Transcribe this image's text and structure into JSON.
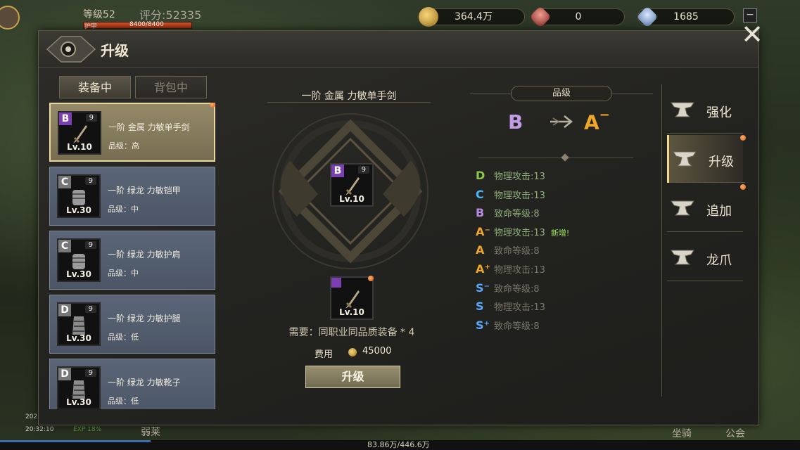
{
  "hud": {
    "level": "等级52",
    "score": "评分:52335",
    "hp_label": "护甲",
    "hp_value": "8400/8400",
    "hp_fraction": 1.0,
    "gold": "364.4万",
    "ruby": "0",
    "crystal": "1685",
    "minimize": "−",
    "date": "202",
    "time": "20:32:10",
    "exp_label": "EXP 18%",
    "exp_total": "83.86万/446.6万",
    "exp_fraction": 0.188,
    "skill_label": "弱莱",
    "mount_label": "坐骑",
    "guild_label": "公会"
  },
  "panel": {
    "title": "升级",
    "close": "✕"
  },
  "tabs": {
    "equipped": "装备中",
    "bag": "背包中"
  },
  "items": [
    {
      "grade": "B",
      "stack": "9",
      "level": "Lv.10",
      "name": "一阶 金属 力敏单手剑",
      "quality": "品级：高",
      "selected": true,
      "dot": true
    },
    {
      "grade": "C",
      "stack": "9",
      "level": "Lv.30",
      "name": "一阶 绿龙 力敏铠甲",
      "quality": "品级：中",
      "selected": false,
      "dot": false
    },
    {
      "grade": "C",
      "stack": "9",
      "level": "Lv.30",
      "name": "一阶 绿龙 力敏护肩",
      "quality": "品级：中",
      "selected": false,
      "dot": false
    },
    {
      "grade": "D",
      "stack": "9",
      "level": "Lv.30",
      "name": "一阶 绿龙 力敏护腿",
      "quality": "品级：低",
      "selected": false,
      "dot": false
    },
    {
      "grade": "D",
      "stack": "9",
      "level": "Lv.30",
      "name": "一阶 绿龙 力敏靴子",
      "quality": "品级：低",
      "selected": false,
      "dot": false
    }
  ],
  "center": {
    "title": "一阶 金属 力敏单手剑",
    "slot_grade": "B",
    "slot_stack": "9",
    "slot_level": "Lv.10",
    "material_level": "Lv.10",
    "need": "需要：同职业同品质装备 * 4",
    "cost_label": "费用",
    "cost_value": "45000",
    "upgrade_button": "升级"
  },
  "quality": {
    "header": "品级",
    "from": "B",
    "to": "A",
    "to_suffix": "−"
  },
  "stats": [
    {
      "grade": "D",
      "grade_class": "g-d",
      "text": "物理攻击:13",
      "dim": false,
      "new": ""
    },
    {
      "grade": "C",
      "grade_class": "g-c",
      "text": "物理攻击:13",
      "dim": false,
      "new": ""
    },
    {
      "grade": "B",
      "grade_class": "g-b",
      "text": "致命等级:8",
      "dim": false,
      "new": ""
    },
    {
      "grade": "A⁻",
      "grade_class": "g-a",
      "text": "物理攻击:13",
      "dim": false,
      "new": "新增!"
    },
    {
      "grade": "A",
      "grade_class": "g-a",
      "text": "致命等级:8",
      "dim": true,
      "new": ""
    },
    {
      "grade": "A⁺",
      "grade_class": "g-a",
      "text": "物理攻击:13",
      "dim": true,
      "new": ""
    },
    {
      "grade": "S⁻",
      "grade_class": "g-s",
      "text": "致命等级:8",
      "dim": true,
      "new": ""
    },
    {
      "grade": "S",
      "grade_class": "g-s",
      "text": "物理攻击:13",
      "dim": true,
      "new": ""
    },
    {
      "grade": "S⁺",
      "grade_class": "g-s",
      "text": "致命等级:8",
      "dim": true,
      "new": ""
    }
  ],
  "menu": [
    {
      "label": "强化",
      "icon": "anvil-icon",
      "active": false,
      "dot": false
    },
    {
      "label": "升级",
      "icon": "anvil-icon",
      "active": true,
      "dot": true
    },
    {
      "label": "追加",
      "icon": "anvil-icon",
      "active": false,
      "dot": true
    },
    {
      "label": "龙爪",
      "icon": "anvil-icon",
      "active": false,
      "dot": false
    }
  ],
  "colors": {
    "gold_text": "#f0a82a",
    "grade_b": "#b68be0",
    "new_tag": "#9be35b",
    "notify_dot": "#d2591c"
  }
}
